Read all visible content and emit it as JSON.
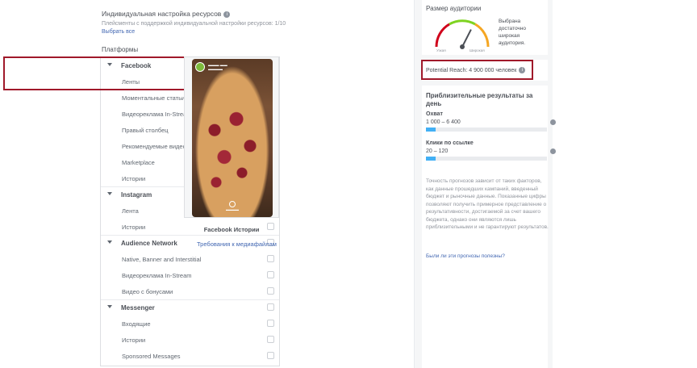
{
  "resources": {
    "title": "Индивидуальная настройка ресурсов",
    "subtitle": "Плейсменты с поддержкой индивидуальной настройки ресурсов: 1/10",
    "select_all": "Выбрать все"
  },
  "platforms": {
    "title": "Платформы",
    "groups": [
      {
        "name": "Facebook",
        "checked": true,
        "items": [
          {
            "label": "Ленты",
            "checked": true
          },
          {
            "label": "Моментальные статьи",
            "checked": false
          },
          {
            "label": "Видеореклама In-Stream",
            "checked": false
          },
          {
            "label": "Правый столбец",
            "checked": false
          },
          {
            "label": "Рекомендуемые видео",
            "checked": false
          },
          {
            "label": "Marketplace",
            "checked": false
          },
          {
            "label": "Истории",
            "checked": false
          }
        ]
      },
      {
        "name": "Instagram",
        "checked": false,
        "items": [
          {
            "label": "Лента",
            "checked": false
          },
          {
            "label": "Истории",
            "checked": false
          }
        ]
      },
      {
        "name": "Audience Network",
        "checked": false,
        "items": [
          {
            "label": "Native, Banner and Interstitial",
            "checked": false
          },
          {
            "label": "Видеореклама In-Stream",
            "checked": false
          },
          {
            "label": "Видео с бонусами",
            "checked": false
          }
        ]
      },
      {
        "name": "Messenger",
        "checked": false,
        "items": [
          {
            "label": "Входящие",
            "checked": false
          },
          {
            "label": "Истории",
            "checked": false
          },
          {
            "label": "Sponsored Messages",
            "checked": false
          }
        ]
      }
    ]
  },
  "preview": {
    "caption": "Facebook Истории",
    "media_link": "Требования к медиафайлам"
  },
  "audience": {
    "title": "Размер аудитории",
    "label_narrow": "Узкая",
    "label_wide": "Широкая",
    "description": "Выбрана достаточно широкая аудитория.",
    "gauge_level": 0.65,
    "potential_reach": "Potential Reach: 4 900 000 человек"
  },
  "estimates": {
    "title": "Приблизительные результаты за день",
    "reach": {
      "label": "Охват",
      "value": "1 000 – 6 400",
      "level": 0.08
    },
    "clicks": {
      "label": "Клики по ссылке",
      "value": "20 – 120",
      "level": 0.08
    },
    "disclaimer": "Точность прогнозов зависит от таких факторов, как данные прошедших кампаний, введенный бюджет и рыночные данные. Показанные цифры позволяют получить примерное представление о результативности, достигаемой за счет вашего бюджета, однако они являются лишь приблизительными и не гарантируют результатов.",
    "feedback_link": "Были ли эти прогнозы полезны?"
  },
  "colors": {
    "highlight": "#a0192a",
    "link": "#4267b2",
    "bar": "#42b0f5"
  }
}
